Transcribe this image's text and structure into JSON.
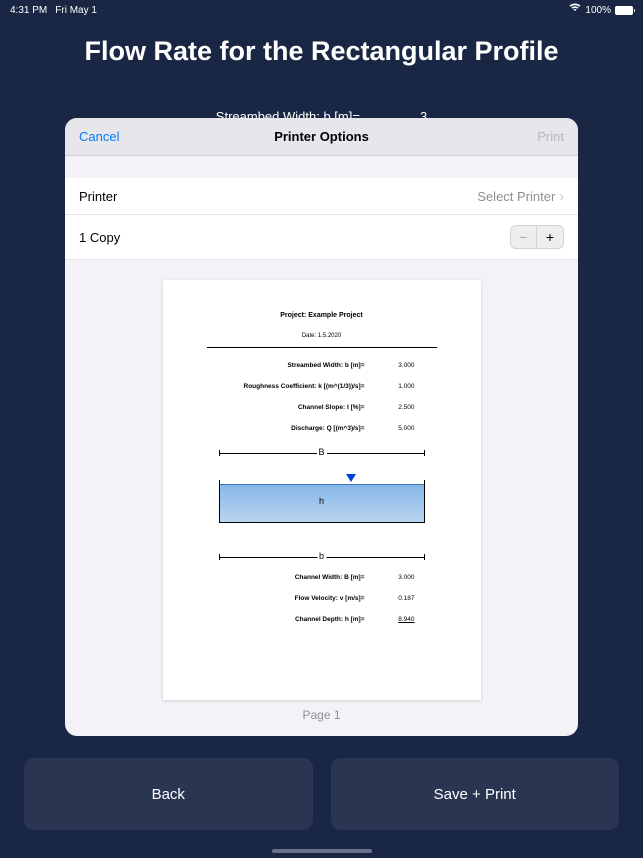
{
  "status": {
    "time": "4:31 PM",
    "date": "Fri May 1",
    "battery": "100%"
  },
  "page": {
    "title": "Flow Rate for the Rectangular Profile",
    "bgFieldLabel": "Streambed Width: b [m]=",
    "bgFieldValue": "3"
  },
  "modal": {
    "cancel": "Cancel",
    "title": "Printer Options",
    "print": "Print",
    "printerLabel": "Printer",
    "printerValue": "Select Printer",
    "copyLabel": "1 Copy"
  },
  "preview": {
    "project": "Project: Example Project",
    "date": "Date: 1.5.2020",
    "params": [
      {
        "label": "Streambed Width: b [m]=",
        "val": "3.000"
      },
      {
        "label": "Roughness Coefficient: k [(m^(1/3))/s]=",
        "val": "1.000"
      },
      {
        "label": "Channel Slope: I [%]=",
        "val": "2.500"
      },
      {
        "label": "Discharge: Q [(m^3)/s]=",
        "val": "5.000"
      }
    ],
    "dimTop": "B",
    "dimBot": "b",
    "hLabel": "h",
    "results": [
      {
        "label": "Channel Width: B [m]=",
        "val": "3.000",
        "u": false
      },
      {
        "label": "Flow Velocity: v [m/s]=",
        "val": "0.187",
        "u": false
      },
      {
        "label": "Channel Depth: h [m]=",
        "val": "8.940",
        "u": true
      }
    ],
    "pageNum": "Page 1"
  },
  "buttons": {
    "back": "Back",
    "savePrint": "Save + Print"
  }
}
